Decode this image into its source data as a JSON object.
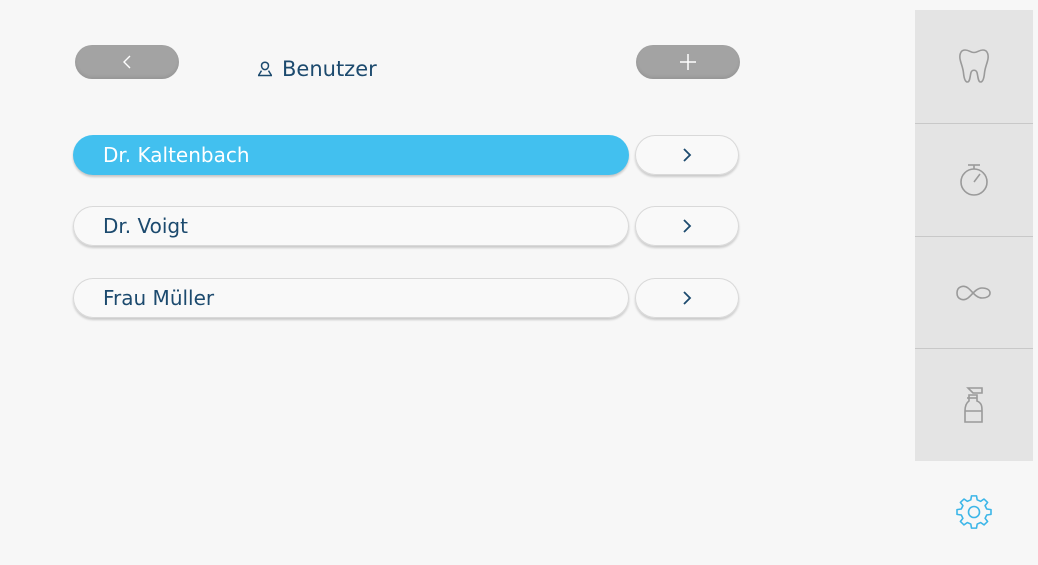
{
  "header": {
    "title": "Benutzer",
    "back_icon": "chevron-left-icon",
    "add_icon": "plus-icon",
    "user_icon": "user-icon"
  },
  "users": [
    {
      "name": "Dr. Kaltenbach",
      "selected": true
    },
    {
      "name": "Dr. Voigt",
      "selected": false
    },
    {
      "name": "Frau Müller",
      "selected": false
    }
  ],
  "sidebar": {
    "items": [
      {
        "icon": "tooth-icon"
      },
      {
        "icon": "stopwatch-icon"
      },
      {
        "icon": "infinity-icon"
      },
      {
        "icon": "spray-bottle-icon"
      }
    ],
    "settings_icon": "gear-icon",
    "settings_active": true
  },
  "colors": {
    "accent": "#42c0ef",
    "text": "#1c4a6e",
    "button_gray": "#a3a3a3",
    "sidebar_bg": "#e4e4e4",
    "icon_gray": "#9a9a9a",
    "active_icon": "#3cb6e8"
  }
}
